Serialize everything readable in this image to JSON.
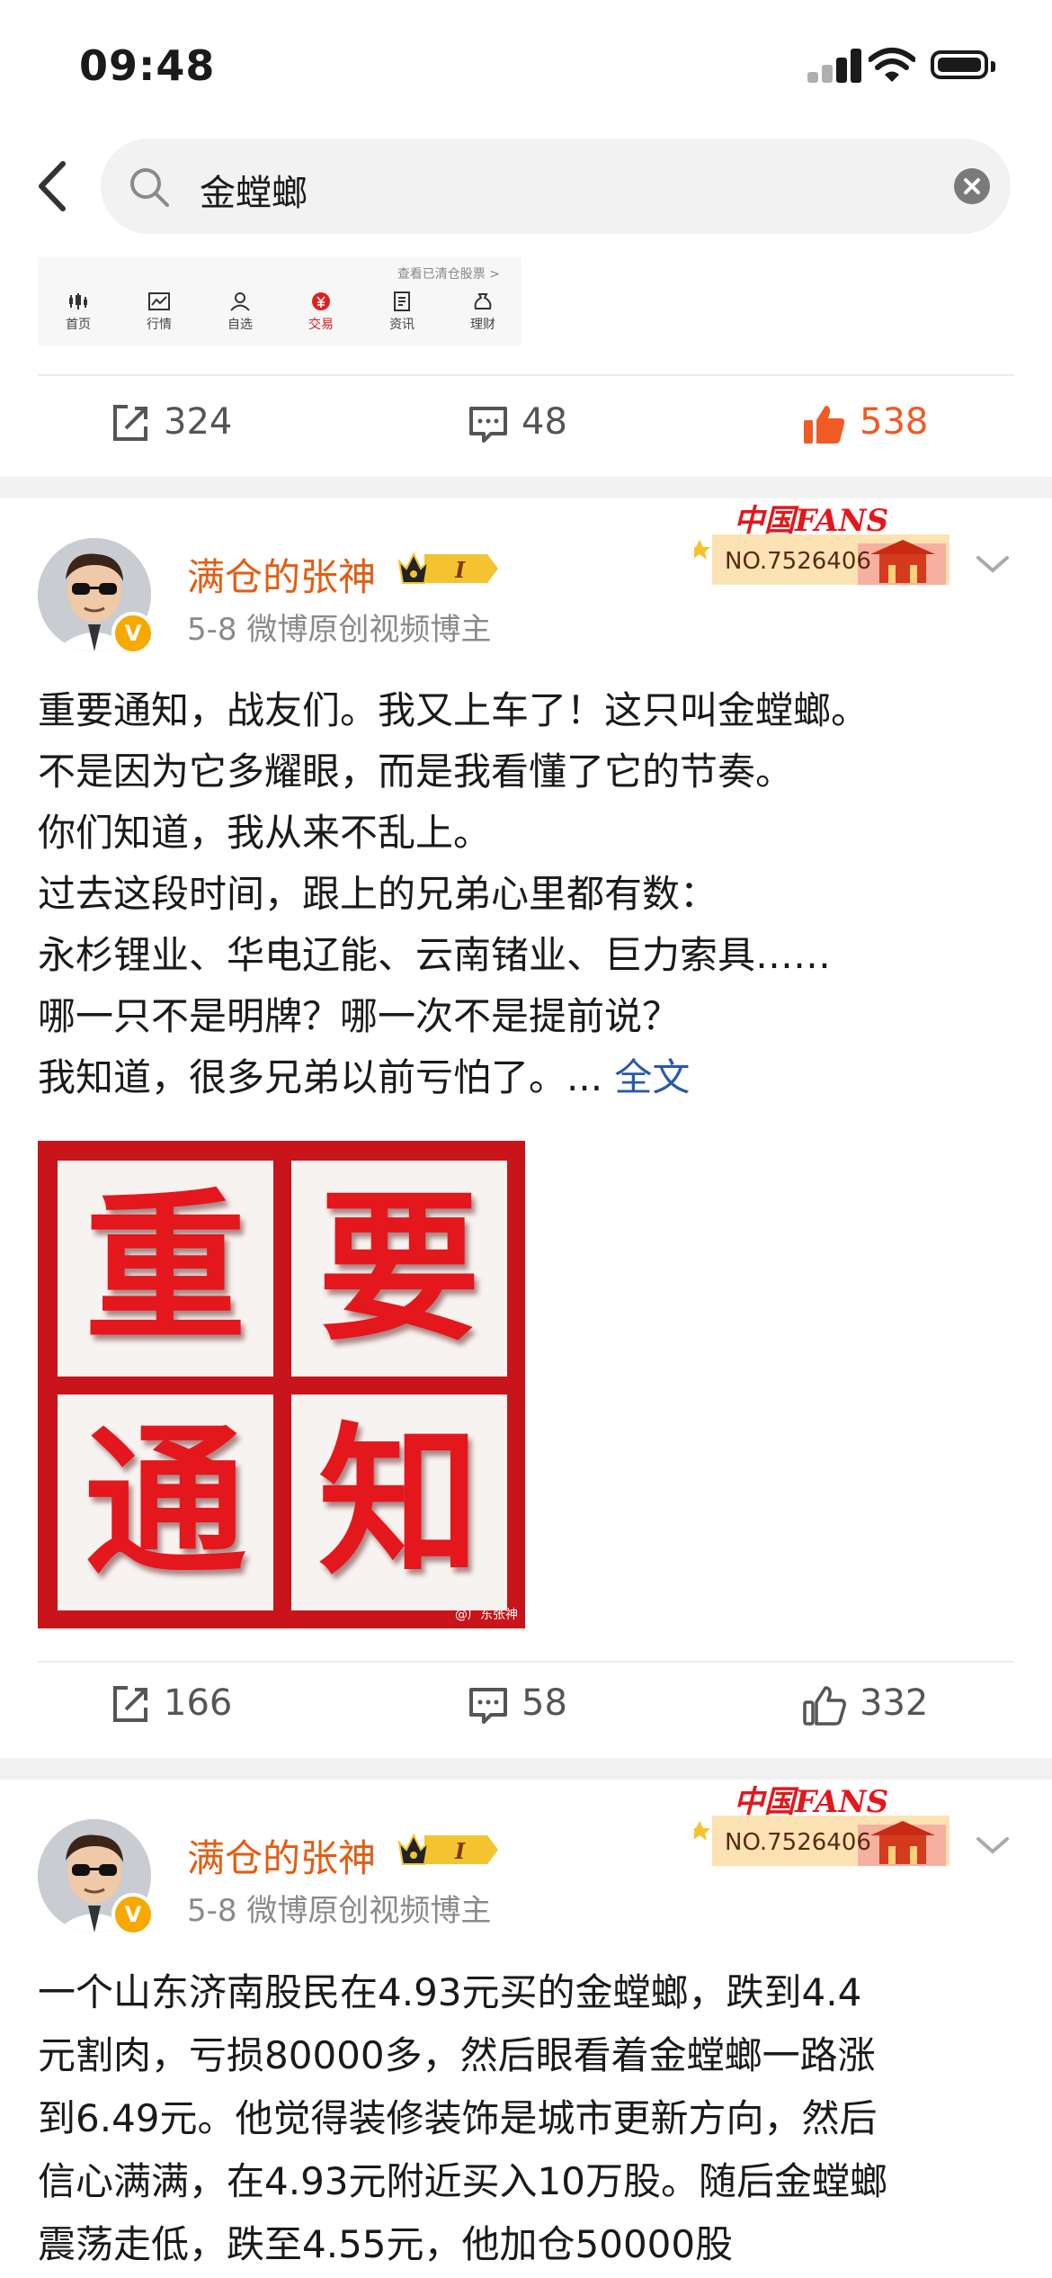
{
  "status": {
    "time": "09:48"
  },
  "search": {
    "query": "金螳螂"
  },
  "tabstrip": {
    "note": "查看已清仓股票 >",
    "tabs": [
      "首页",
      "行情",
      "自选",
      "交易",
      "资讯",
      "理财"
    ]
  },
  "post0_actions": {
    "repost": "324",
    "comment": "48",
    "like": "538"
  },
  "post1": {
    "author": "满仓的张神",
    "level": "I",
    "date": "5-8",
    "source": "微博原创视频博主",
    "fans_text": "中国FANS",
    "fans_no": "NO.7526406",
    "lines": [
      "重要通知，战友们。我又上车了！这只叫金螳螂。",
      "不是因为它多耀眼，而是我看懂了它的节奏。",
      "你们知道，我从来不乱上。",
      "过去这段时间，跟上的兄弟心里都有数：",
      "永杉锂业、华电辽能、云南锗业、巨力索具……",
      "哪一只不是明牌？哪一次不是提前说？",
      "我知道，很多兄弟以前亏怕了。... "
    ],
    "more": "全文",
    "image_chars": [
      "重",
      "要",
      "通",
      "知"
    ],
    "image_watermark": "@广东张神",
    "actions": {
      "repost": "166",
      "comment": "58",
      "like": "332"
    }
  },
  "post2": {
    "author": "满仓的张神",
    "level": "I",
    "date": "5-8",
    "source": "微博原创视频博主",
    "fans_text": "中国FANS",
    "fans_no": "NO.7526406",
    "lines": [
      "一个山东济南股民在4.93元买的金螳螂，跌到4.4",
      "元割肉，亏损80000多，然后眼看着金螳螂一路涨",
      "到6.49元。他觉得装修装饰是城市更新方向，然后",
      "信心满满，在4.93元附近买入10万股。随后金螳螂",
      "震荡走低，跌至4.55元，他加仓50000股"
    ]
  },
  "colors": {
    "accent_orange": "#e35d13",
    "like_active": "#f05a24",
    "link": "#2a5aa8"
  }
}
